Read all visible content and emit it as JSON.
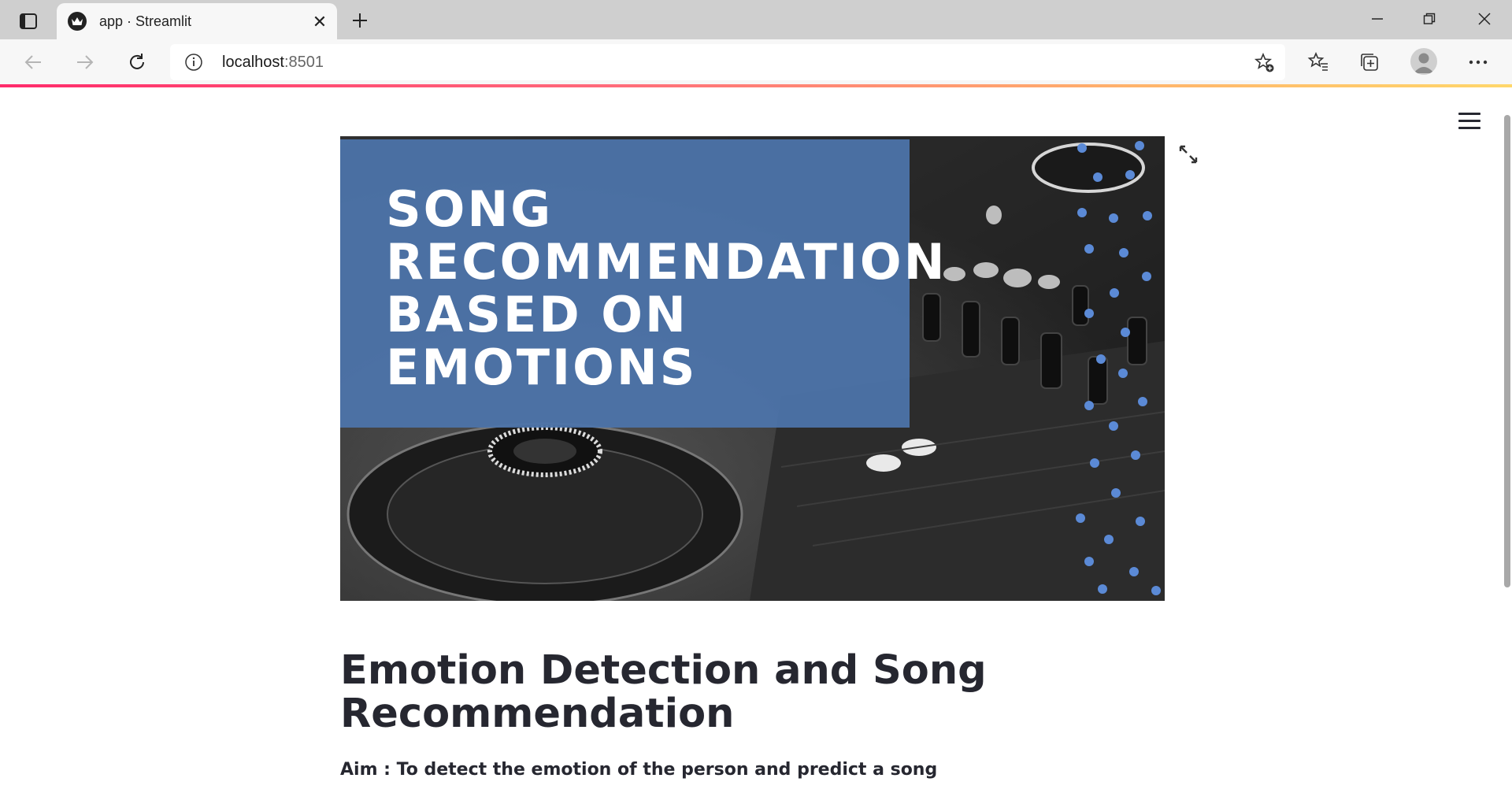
{
  "browser": {
    "tab": {
      "title": "app · Streamlit",
      "close_glyph": "✕"
    },
    "address": {
      "host": "localhost",
      "port": ":8501"
    }
  },
  "page": {
    "banner_title": "SONG RECOMMENDATION BASED ON EMOTIONS",
    "heading": "Emotion Detection and Song Recommendation",
    "aim": "Aim : To detect the emotion of the person and predict a song"
  },
  "colors": {
    "accent_blue": "#4c74aa",
    "dot_blue": "#5b8ad6",
    "text": "#262730"
  }
}
